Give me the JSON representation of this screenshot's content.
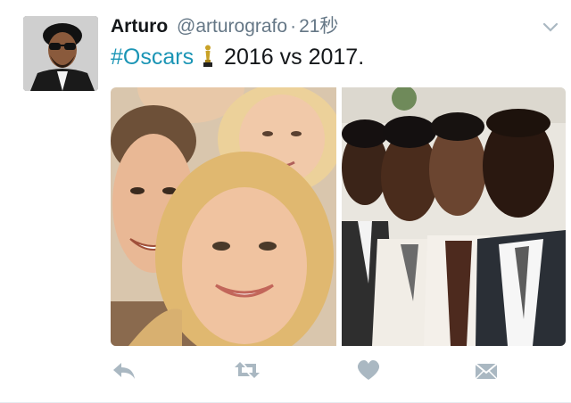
{
  "tweet": {
    "author_name": "Arturo",
    "handle": "@arturografo",
    "separator": "·",
    "timestamp": "21秒",
    "hashtag": "#Oscars",
    "text_after": "2016 vs 2017."
  },
  "icons": {
    "avatar": "avatar-image",
    "caret": "chevron-down-icon",
    "oscar": "oscar-statuette-emoji",
    "reply": "reply-icon",
    "retweet": "retweet-icon",
    "like": "heart-icon",
    "message": "direct-message-icon"
  },
  "colors": {
    "hashtag": "#1b95b5",
    "name": "#14171a",
    "meta": "#657786",
    "action_icons": "#aab8c2"
  }
}
